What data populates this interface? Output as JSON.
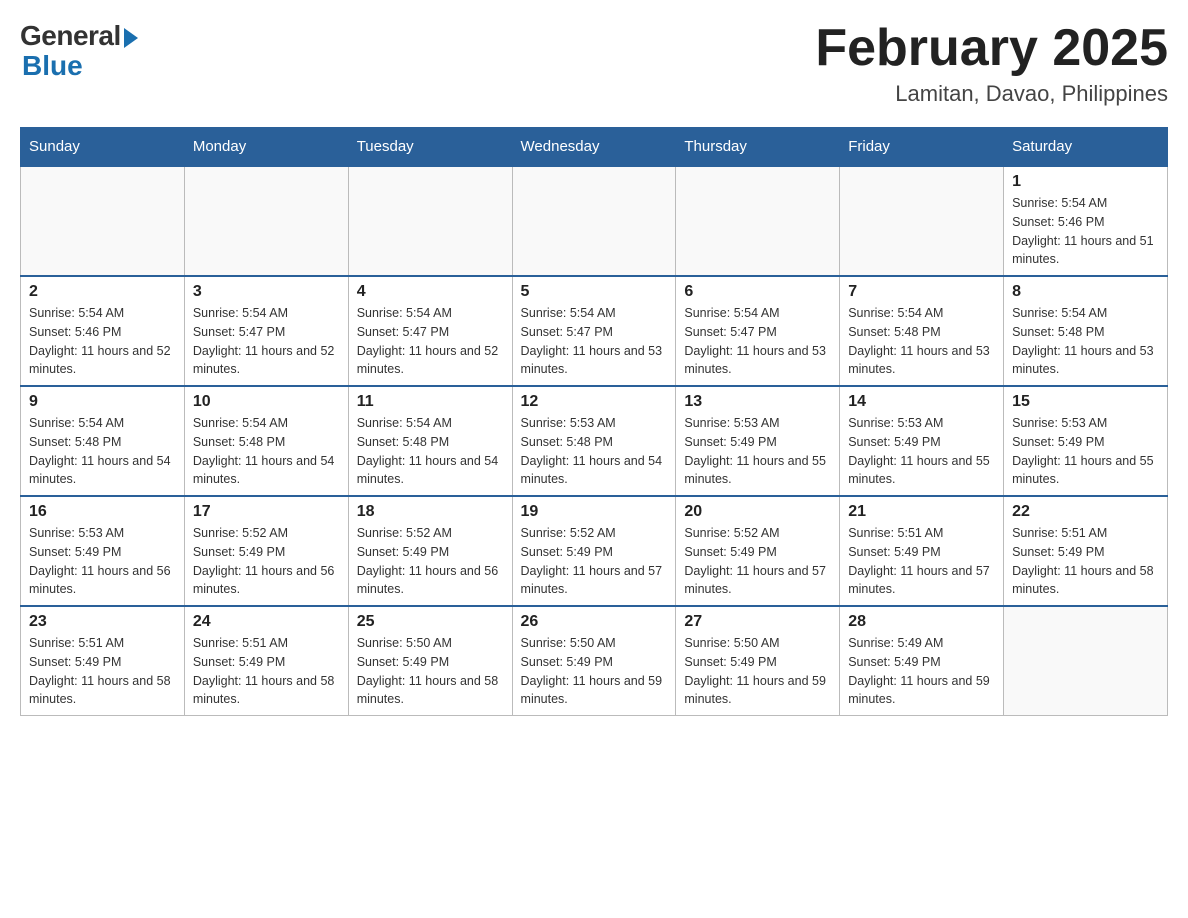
{
  "header": {
    "logo_general": "General",
    "logo_blue": "Blue",
    "month_title": "February 2025",
    "location": "Lamitan, Davao, Philippines"
  },
  "days_of_week": [
    "Sunday",
    "Monday",
    "Tuesday",
    "Wednesday",
    "Thursday",
    "Friday",
    "Saturday"
  ],
  "weeks": [
    {
      "days": [
        {
          "num": "",
          "empty": true
        },
        {
          "num": "",
          "empty": true
        },
        {
          "num": "",
          "empty": true
        },
        {
          "num": "",
          "empty": true
        },
        {
          "num": "",
          "empty": true
        },
        {
          "num": "",
          "empty": true
        },
        {
          "num": "1",
          "sunrise": "5:54 AM",
          "sunset": "5:46 PM",
          "daylight": "11 hours and 51 minutes."
        }
      ]
    },
    {
      "days": [
        {
          "num": "2",
          "sunrise": "5:54 AM",
          "sunset": "5:46 PM",
          "daylight": "11 hours and 52 minutes."
        },
        {
          "num": "3",
          "sunrise": "5:54 AM",
          "sunset": "5:47 PM",
          "daylight": "11 hours and 52 minutes."
        },
        {
          "num": "4",
          "sunrise": "5:54 AM",
          "sunset": "5:47 PM",
          "daylight": "11 hours and 52 minutes."
        },
        {
          "num": "5",
          "sunrise": "5:54 AM",
          "sunset": "5:47 PM",
          "daylight": "11 hours and 53 minutes."
        },
        {
          "num": "6",
          "sunrise": "5:54 AM",
          "sunset": "5:47 PM",
          "daylight": "11 hours and 53 minutes."
        },
        {
          "num": "7",
          "sunrise": "5:54 AM",
          "sunset": "5:48 PM",
          "daylight": "11 hours and 53 minutes."
        },
        {
          "num": "8",
          "sunrise": "5:54 AM",
          "sunset": "5:48 PM",
          "daylight": "11 hours and 53 minutes."
        }
      ]
    },
    {
      "days": [
        {
          "num": "9",
          "sunrise": "5:54 AM",
          "sunset": "5:48 PM",
          "daylight": "11 hours and 54 minutes."
        },
        {
          "num": "10",
          "sunrise": "5:54 AM",
          "sunset": "5:48 PM",
          "daylight": "11 hours and 54 minutes."
        },
        {
          "num": "11",
          "sunrise": "5:54 AM",
          "sunset": "5:48 PM",
          "daylight": "11 hours and 54 minutes."
        },
        {
          "num": "12",
          "sunrise": "5:53 AM",
          "sunset": "5:48 PM",
          "daylight": "11 hours and 54 minutes."
        },
        {
          "num": "13",
          "sunrise": "5:53 AM",
          "sunset": "5:49 PM",
          "daylight": "11 hours and 55 minutes."
        },
        {
          "num": "14",
          "sunrise": "5:53 AM",
          "sunset": "5:49 PM",
          "daylight": "11 hours and 55 minutes."
        },
        {
          "num": "15",
          "sunrise": "5:53 AM",
          "sunset": "5:49 PM",
          "daylight": "11 hours and 55 minutes."
        }
      ]
    },
    {
      "days": [
        {
          "num": "16",
          "sunrise": "5:53 AM",
          "sunset": "5:49 PM",
          "daylight": "11 hours and 56 minutes."
        },
        {
          "num": "17",
          "sunrise": "5:52 AM",
          "sunset": "5:49 PM",
          "daylight": "11 hours and 56 minutes."
        },
        {
          "num": "18",
          "sunrise": "5:52 AM",
          "sunset": "5:49 PM",
          "daylight": "11 hours and 56 minutes."
        },
        {
          "num": "19",
          "sunrise": "5:52 AM",
          "sunset": "5:49 PM",
          "daylight": "11 hours and 57 minutes."
        },
        {
          "num": "20",
          "sunrise": "5:52 AM",
          "sunset": "5:49 PM",
          "daylight": "11 hours and 57 minutes."
        },
        {
          "num": "21",
          "sunrise": "5:51 AM",
          "sunset": "5:49 PM",
          "daylight": "11 hours and 57 minutes."
        },
        {
          "num": "22",
          "sunrise": "5:51 AM",
          "sunset": "5:49 PM",
          "daylight": "11 hours and 58 minutes."
        }
      ]
    },
    {
      "days": [
        {
          "num": "23",
          "sunrise": "5:51 AM",
          "sunset": "5:49 PM",
          "daylight": "11 hours and 58 minutes."
        },
        {
          "num": "24",
          "sunrise": "5:51 AM",
          "sunset": "5:49 PM",
          "daylight": "11 hours and 58 minutes."
        },
        {
          "num": "25",
          "sunrise": "5:50 AM",
          "sunset": "5:49 PM",
          "daylight": "11 hours and 58 minutes."
        },
        {
          "num": "26",
          "sunrise": "5:50 AM",
          "sunset": "5:49 PM",
          "daylight": "11 hours and 59 minutes."
        },
        {
          "num": "27",
          "sunrise": "5:50 AM",
          "sunset": "5:49 PM",
          "daylight": "11 hours and 59 minutes."
        },
        {
          "num": "28",
          "sunrise": "5:49 AM",
          "sunset": "5:49 PM",
          "daylight": "11 hours and 59 minutes."
        },
        {
          "num": "",
          "empty": true
        }
      ]
    }
  ]
}
